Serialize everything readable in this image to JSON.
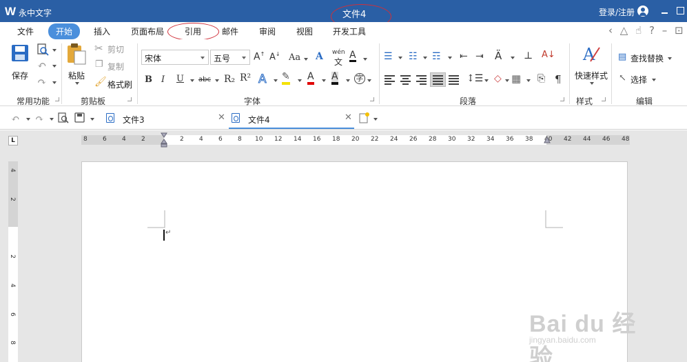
{
  "titlebar": {
    "logo": "W",
    "app_name": "永中文字",
    "document_title": "文件4",
    "login": "登录/注册"
  },
  "menu": {
    "tabs": [
      "文件",
      "开始",
      "插入",
      "页面布局",
      "引用",
      "邮件",
      "审阅",
      "视图",
      "开发工具"
    ],
    "active": "开始"
  },
  "ribbon": {
    "common": {
      "save": "保存",
      "group": "常用功能"
    },
    "clipboard": {
      "paste": "粘贴",
      "cut": "剪切",
      "copy": "复制",
      "format_painter": "格式刷",
      "group": "剪贴板"
    },
    "font": {
      "font_name": "宋体",
      "font_size": "五号",
      "bold": "B",
      "italic": "I",
      "underline": "U",
      "strikethrough": "abc",
      "subscript": "R₂",
      "superscript": "R²",
      "case": "Aa",
      "pinyin": "wén",
      "group": "字体"
    },
    "paragraph": {
      "group": "段落"
    },
    "styles": {
      "quick_styles": "快速样式",
      "group": "样式"
    },
    "editing": {
      "find_replace": "查找替换",
      "select": "选择",
      "group": "编辑"
    }
  },
  "doc_tabs": [
    {
      "name": "文件3",
      "active": false
    },
    {
      "name": "文件4",
      "active": true
    }
  ],
  "ruler": {
    "h_ticks": [
      "8",
      "6",
      "4",
      "2",
      "2",
      "4",
      "6",
      "8",
      "10",
      "12",
      "14",
      "16",
      "18",
      "20",
      "22",
      "24",
      "26",
      "28",
      "30",
      "32",
      "34",
      "36",
      "38",
      "40",
      "42",
      "44",
      "46",
      "48"
    ],
    "v_ticks": [
      "4",
      "2",
      "2",
      "4",
      "6",
      "8"
    ],
    "corner": "L"
  },
  "document": {
    "paragraph_mark": "↵"
  },
  "watermark": {
    "top": "Bai du 经验",
    "bottom": "jingyan.baidu.com"
  },
  "colors": {
    "titlebar": "#2a5fa5",
    "accent": "#4a8fdc",
    "annotation": "#d0303a"
  }
}
